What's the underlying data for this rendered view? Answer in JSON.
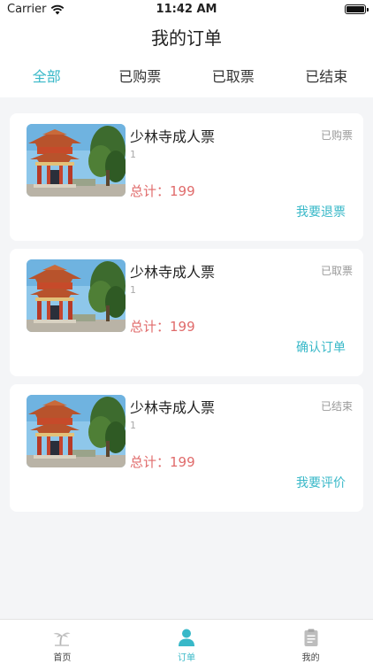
{
  "status_bar": {
    "carrier": "Carrier",
    "time": "11:42 AM"
  },
  "nav": {
    "title": "我的订单"
  },
  "tabs": [
    {
      "label": "全部",
      "active": true
    },
    {
      "label": "已购票",
      "active": false
    },
    {
      "label": "已取票",
      "active": false
    },
    {
      "label": "已结束",
      "active": false
    }
  ],
  "orders": [
    {
      "title": "少林寺成人票",
      "status": "已购票",
      "quantity": "1",
      "total": "总计：199",
      "action": "我要退票"
    },
    {
      "title": "少林寺成人票",
      "status": "已取票",
      "quantity": "1",
      "total": "总计：199",
      "action": "确认订单"
    },
    {
      "title": "少林寺成人票",
      "status": "已结束",
      "quantity": "1",
      "total": "总计：199",
      "action": "我要评价"
    }
  ],
  "tabbar": [
    {
      "label": "首页",
      "icon": "palm-tree-icon"
    },
    {
      "label": "订单",
      "icon": "person-icon",
      "active": true
    },
    {
      "label": "我的",
      "icon": "clipboard-icon"
    }
  ],
  "colors": {
    "accent": "#38b8c8",
    "price": "#e06b6b",
    "status_gray": "#9a9a9a",
    "background": "#f4f5f7"
  }
}
